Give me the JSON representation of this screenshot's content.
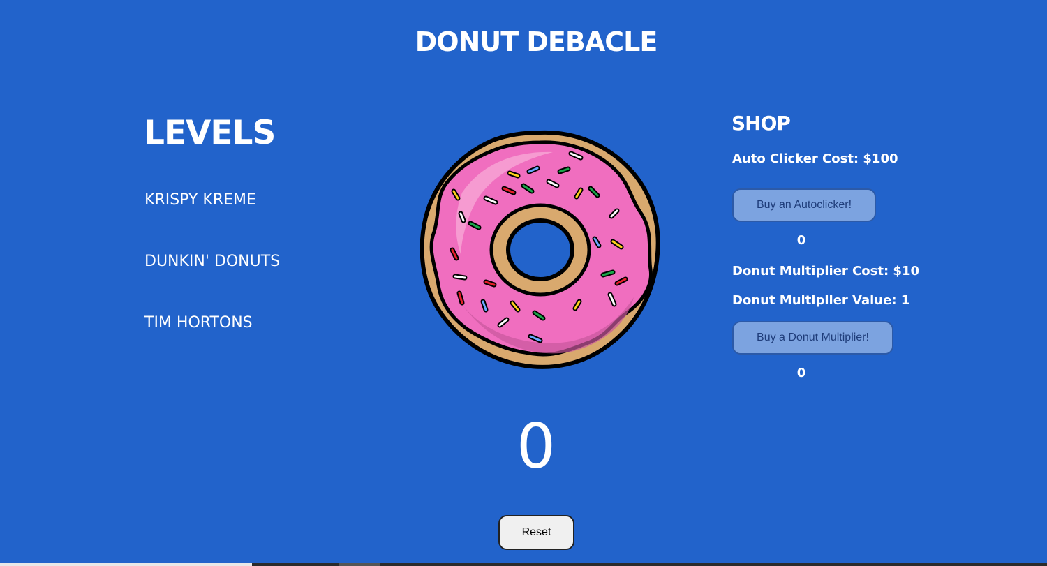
{
  "title": "DONUT DEBACLE",
  "levels": {
    "heading": "LEVELS",
    "items": [
      "KRISPY KREME",
      "DUNKIN' DONUTS",
      "TIM HORTONS"
    ]
  },
  "donut": {
    "icon": "donut-icon",
    "icing_color": "#f06ebf",
    "dough_color": "#d9a96e"
  },
  "shop": {
    "heading": "SHOP",
    "autoclicker_cost": "Auto Clicker Cost: $100",
    "autoclicker_button": "Buy an Autoclicker!",
    "autoclicker_count": "0",
    "multiplier_cost": "Donut Multiplier Cost: $10",
    "multiplier_value": "Donut Multiplier Value: 1",
    "multiplier_button": "Buy a Donut Multiplier!",
    "multiplier_count": "0"
  },
  "score": "0",
  "reset_label": "Reset",
  "colors": {
    "background": "#2263cb",
    "button": "#7ca3e0"
  }
}
